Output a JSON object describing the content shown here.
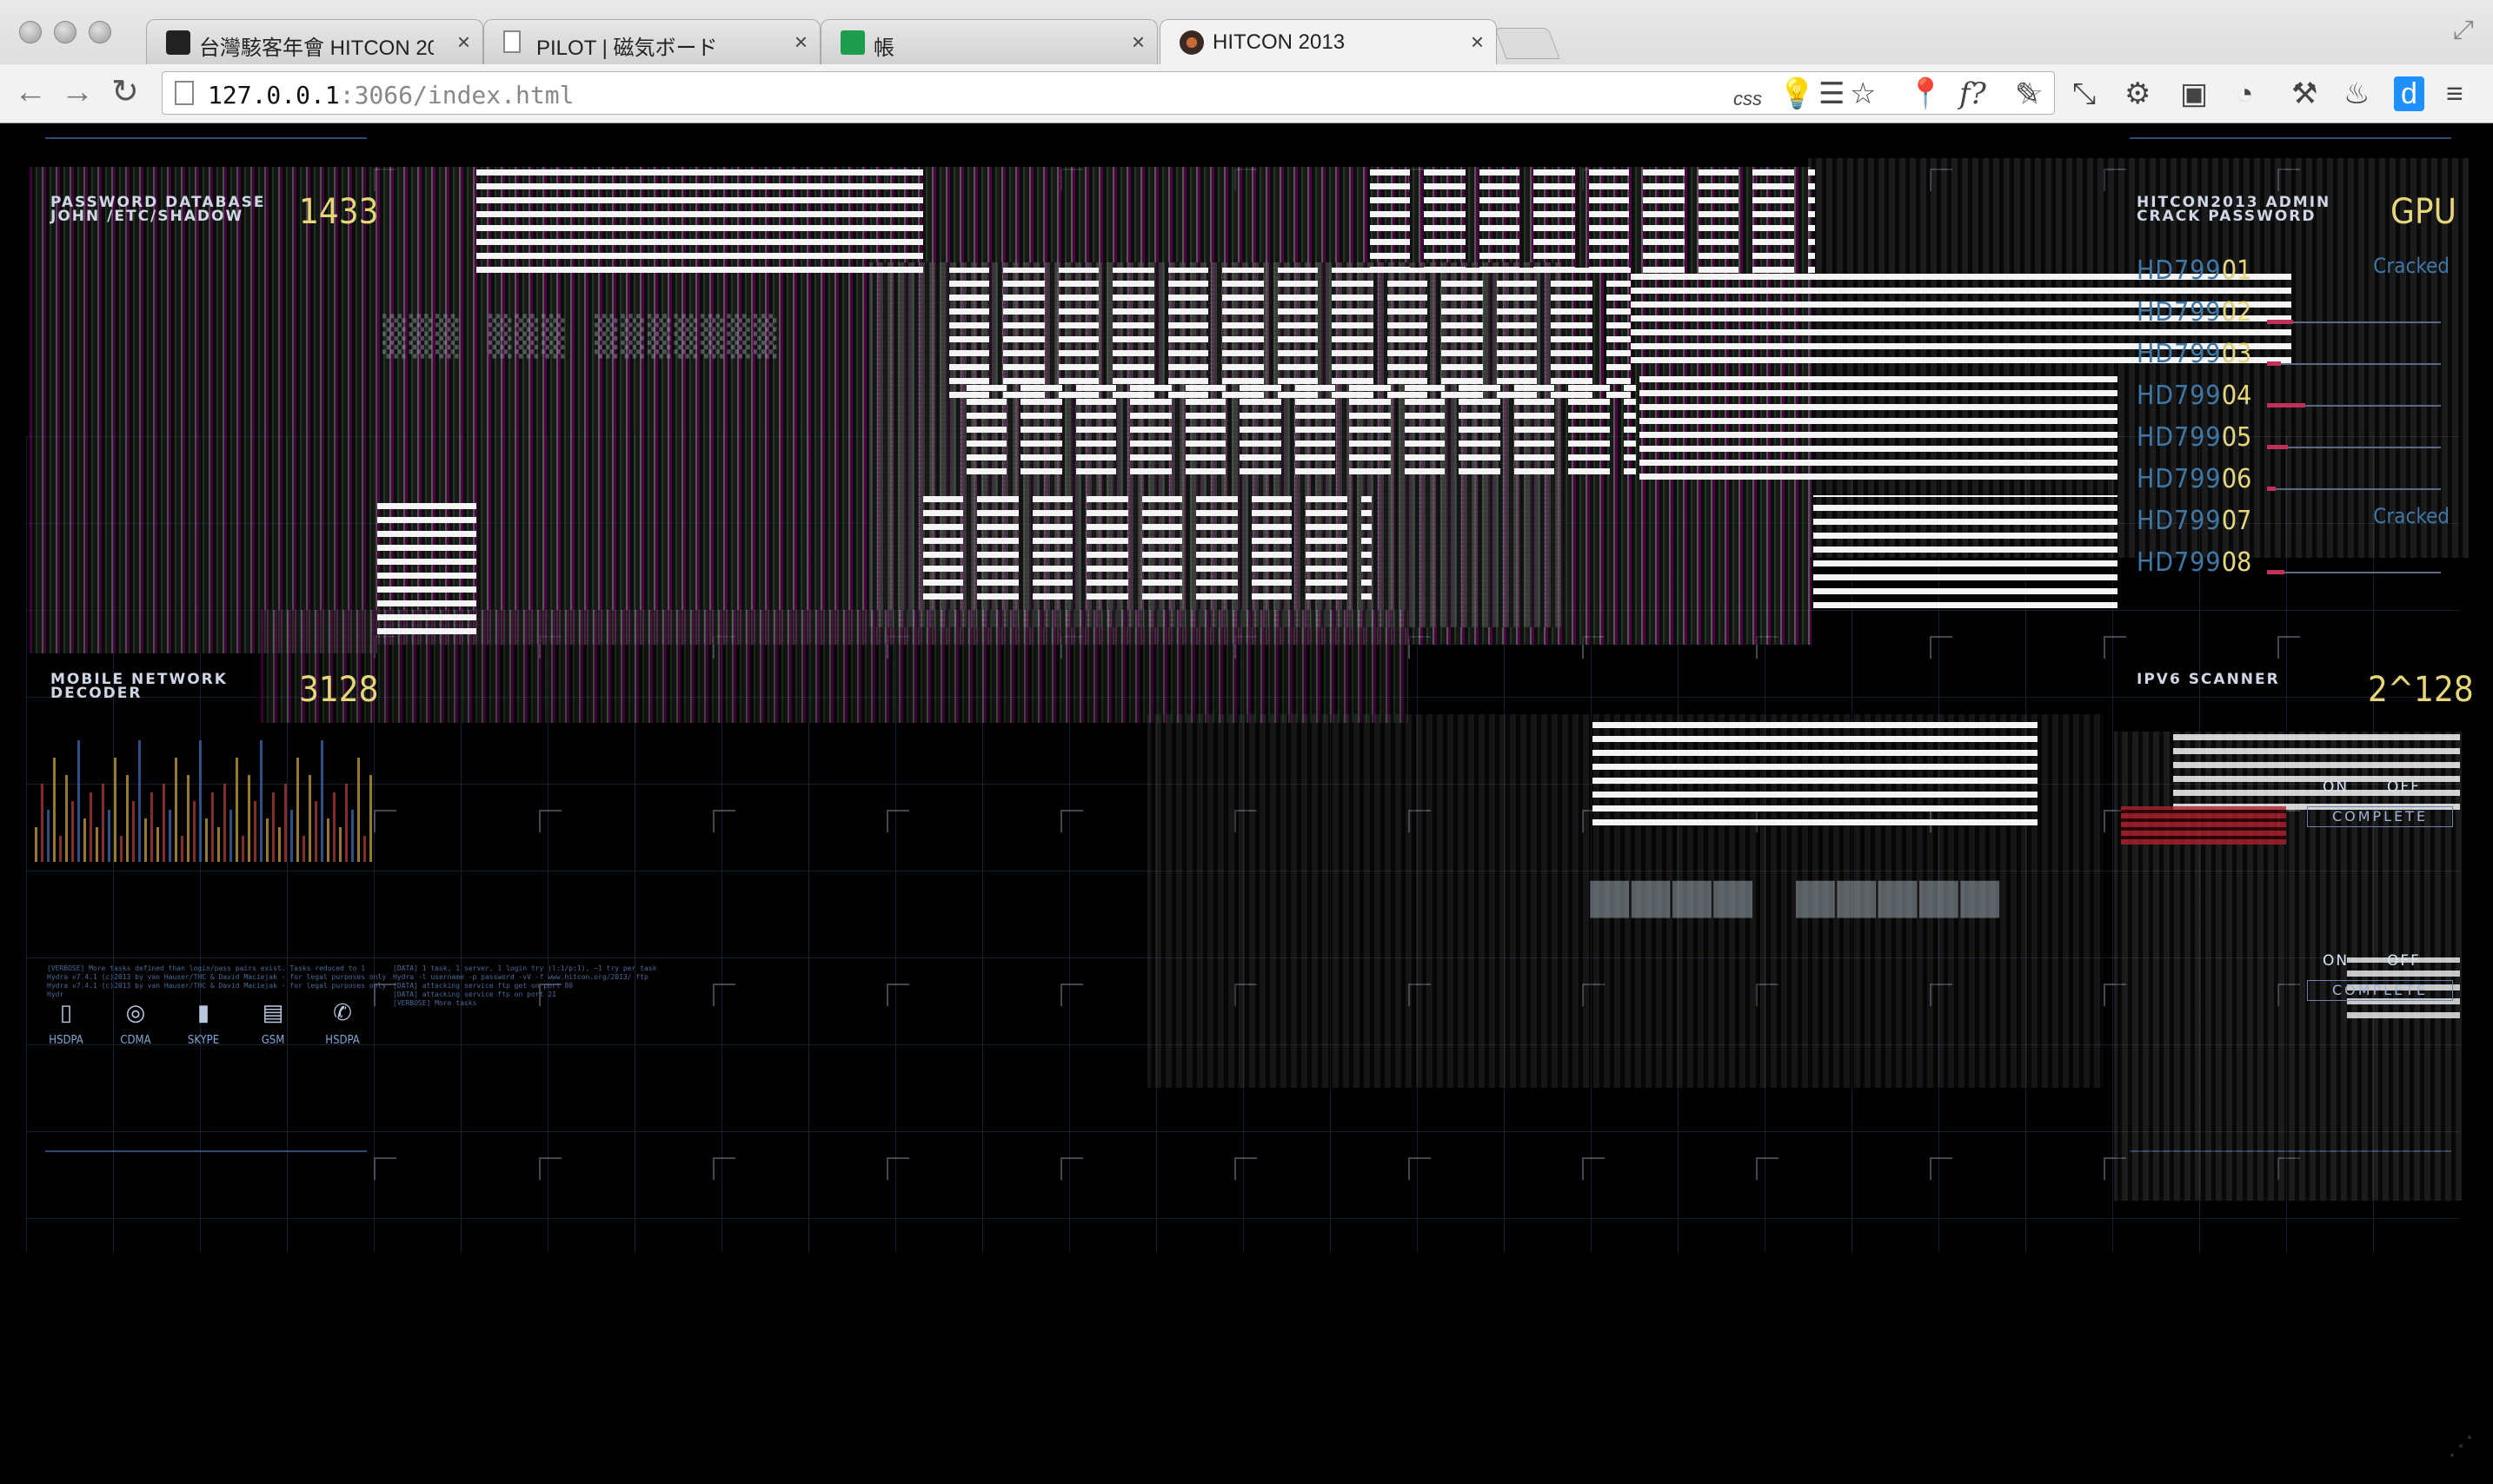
{
  "browser": {
    "tabs": [
      {
        "title": "台灣駭客年會 HITCON 2013",
        "close": "×"
      },
      {
        "title": "PILOT | 磁気ボード",
        "close": "×"
      },
      {
        "title": "帳",
        "close": "×"
      },
      {
        "title": "HITCON 2013",
        "close": "×",
        "active": true
      }
    ],
    "url_host": "127.0.0.1",
    "url_rest": ":3066/index.html",
    "nav": {
      "back": "←",
      "forward": "→",
      "reload": "↻"
    },
    "extensions": [
      {
        "icon": "css-icon",
        "glyph": "css"
      },
      {
        "icon": "lightbulb-icon",
        "glyph": "💡"
      },
      {
        "icon": "feed-icon",
        "glyph": "☰"
      },
      {
        "icon": "bookmark-star-icon",
        "glyph": "☆"
      },
      {
        "icon": "map-pin-icon",
        "glyph": "📍"
      },
      {
        "icon": "font-finder-icon",
        "glyph": "f?"
      },
      {
        "icon": "eyedropper-icon",
        "glyph": "✎"
      },
      {
        "icon": "resize-icon",
        "glyph": "⤡"
      },
      {
        "icon": "settings-icon",
        "glyph": "⚙"
      },
      {
        "icon": "screenshot-icon",
        "glyph": "▣"
      },
      {
        "icon": "timer-icon",
        "glyph": "◔"
      },
      {
        "icon": "tools-icon",
        "glyph": "⚒"
      },
      {
        "icon": "flame-icon",
        "glyph": "♨"
      },
      {
        "icon": "d-icon",
        "glyph": "d"
      },
      {
        "icon": "menu-icon",
        "glyph": "≡"
      }
    ]
  },
  "panels": {
    "password_db": {
      "title_line1": "PASSWORD DATABASE",
      "title_line2": "JOHN /ETC/SHADOW",
      "value": "1433"
    },
    "admin_crack": {
      "title_line1": "HITCON2013 ADMIN",
      "title_line2": "CRACK PASSWORD",
      "value": "GPU"
    },
    "mobile_decoder": {
      "title_line1": "MOBILE NETWORK",
      "title_line2": "DECODER",
      "value": "3128"
    },
    "ipv6_scanner": {
      "title_line1": "IPV6 SCANNER",
      "value": "2^128"
    }
  },
  "gpu_list": [
    {
      "name": "HD7990",
      "index": "01",
      "status": "Cracked",
      "progress": 0.0
    },
    {
      "name": "HD7990",
      "index": "02",
      "status": "",
      "progress": 0.15
    },
    {
      "name": "HD7990",
      "index": "03",
      "status": "",
      "progress": 0.08
    },
    {
      "name": "HD7990",
      "index": "04",
      "status": "",
      "progress": 0.22
    },
    {
      "name": "HD7990",
      "index": "05",
      "status": "",
      "progress": 0.12
    },
    {
      "name": "HD7990",
      "index": "06",
      "status": "",
      "progress": 0.05
    },
    {
      "name": "HD7990",
      "index": "07",
      "status": "Cracked",
      "progress": 0.0
    },
    {
      "name": "HD7990",
      "index": "08",
      "status": "",
      "progress": 0.1
    }
  ],
  "services": [
    {
      "label": "HSDPA",
      "icon": "phone-icon",
      "glyph": "▯"
    },
    {
      "label": "CDMA",
      "icon": "satellite-icon",
      "glyph": "◎"
    },
    {
      "label": "SKYPE",
      "icon": "mobile-icon",
      "glyph": "▮"
    },
    {
      "label": "GSM",
      "icon": "cards-icon",
      "glyph": "▤"
    },
    {
      "label": "HSDPA",
      "icon": "handset-icon",
      "glyph": "✆"
    }
  ],
  "logs": {
    "left": "[VERBOSE] More tasks defined than login/pass pairs exist. Tasks reduced to 1\nHydra v7.4.1 (c)2013 by van Hauser/THC & David Maciejak - for legal purposes only\nHydra v7.4.1 (c)2013 by van Hauser/THC & David Maciejak - for legal purposes only\nHydr",
    "right": "[DATA] 1 task, 1 server, 1 login try (l:1/p:1), ~1 try per task\nHydra -l username -p password -vV -f www.hitcon.org/2013/ ftp\n[DATA] attacking service ftp get on port 80\n[DATA] attacking service ftp on port 21\n[VERBOSE] More tasks"
  },
  "ipv6_switches": [
    {
      "on": "ON",
      "off": "OFF",
      "status": "COMPLETE"
    },
    {
      "on": "ON",
      "off": "OFF",
      "status": "COMPLETE"
    }
  ]
}
